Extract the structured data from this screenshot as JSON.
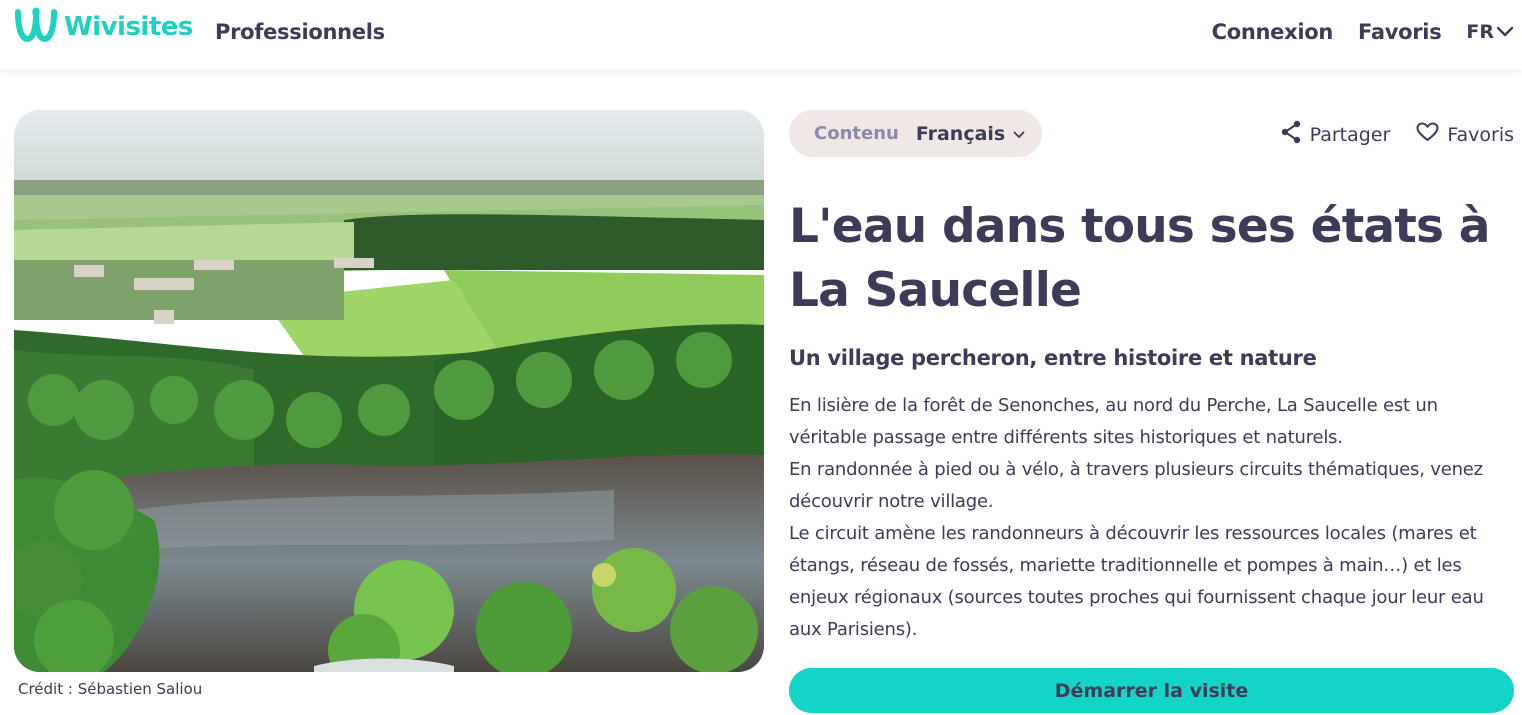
{
  "header": {
    "brand": "Wivisites",
    "nav_professionals": "Professionnels",
    "login": "Connexion",
    "favorites": "Favoris",
    "language": "FR"
  },
  "hero": {
    "credit": "Crédit : Sébastien Saliou"
  },
  "content_language": {
    "label": "Contenu",
    "value": "Français"
  },
  "actions": {
    "share": "Partager",
    "favorite": "Favoris"
  },
  "visit": {
    "title": "L'eau dans tous ses états à La Saucelle",
    "subtitle": "Un village percheron, entre histoire et nature",
    "paragraphs": [
      "En lisière de la forêt de Senonches, au nord du Perche, La Saucelle est un véritable passage entre différents sites historiques et naturels.",
      "En randonnée à pied ou à vélo, à travers plusieurs circuits thématiques, venez découvrir notre village.",
      "Le circuit amène les randonneurs à découvrir les ressources locales (mares et étangs, réseau de fossés, mariette traditionnelle et pompes à main…) et les enjeux régionaux (sources toutes proches qui fournissent chaque jour leur eau aux Parisiens)."
    ],
    "start_button": "Démarrer la visite"
  },
  "colors": {
    "brand": "#1ed1c1",
    "button": "#13d4c6",
    "text": "#3c3c58",
    "pill": "#efe8e6"
  },
  "icons": {
    "logo": "wivisites-logo-icon",
    "chevron": "chevron-down-icon",
    "share": "share-icon",
    "heart": "heart-icon"
  }
}
